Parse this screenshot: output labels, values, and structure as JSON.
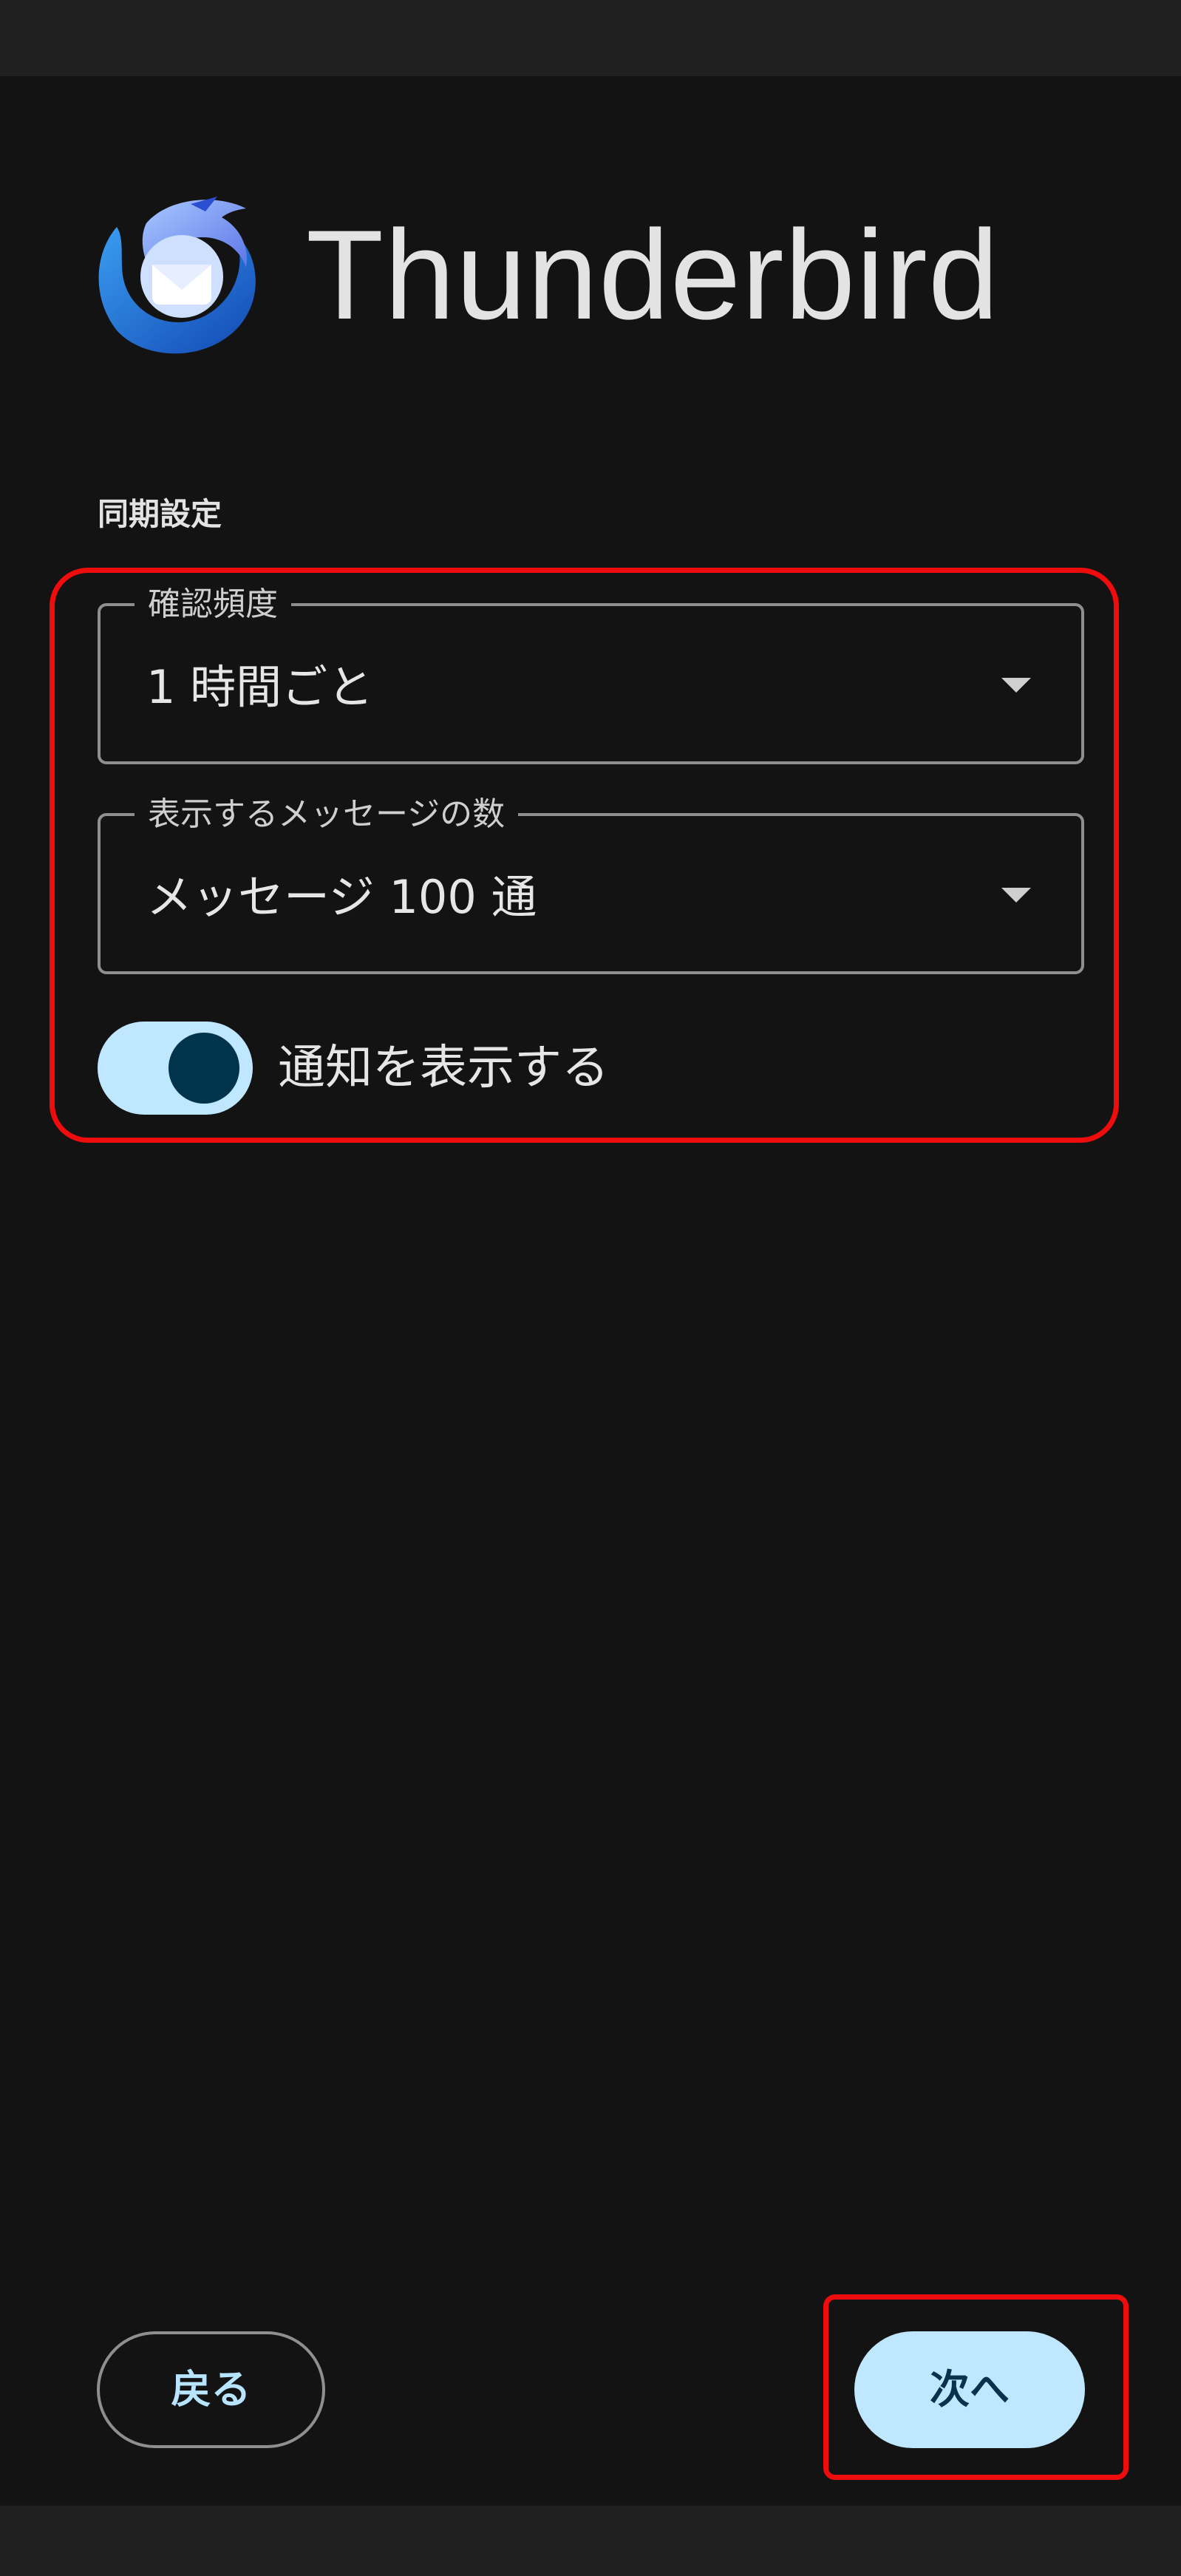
{
  "app": {
    "name": "Thunderbird"
  },
  "sync_settings": {
    "title": "同期設定",
    "check_frequency": {
      "label": "確認頻度",
      "value": "1 時間ごと"
    },
    "messages_to_display": {
      "label": "表示するメッセージの数",
      "value": "メッセージ 100 通"
    },
    "notifications": {
      "label": "通知を表示する",
      "enabled": true
    }
  },
  "footer": {
    "back_label": "戻る",
    "next_label": "次へ"
  },
  "colors": {
    "background": "#131313",
    "accent": "#bfe7ff",
    "highlight": "#ee0c0c",
    "toggle_thumb": "#00344d"
  }
}
